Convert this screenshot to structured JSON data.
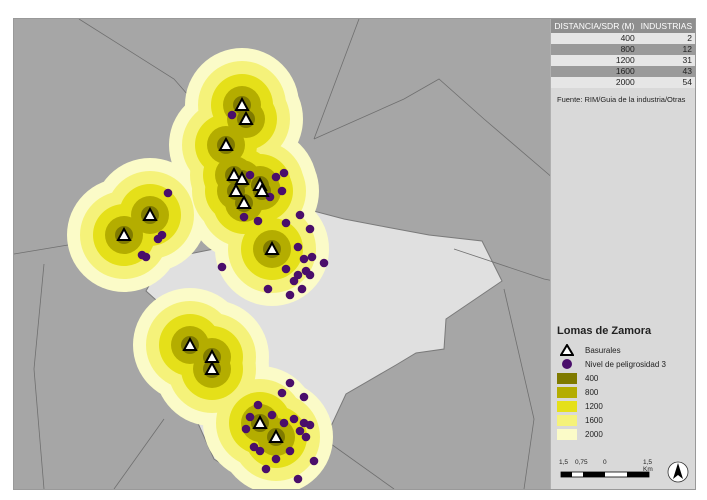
{
  "table": {
    "headers": [
      "DISTANCIA/SDR (M)",
      "INDUSTRIAS"
    ],
    "rows": [
      {
        "distance": "400",
        "count": "2"
      },
      {
        "distance": "800",
        "count": "12"
      },
      {
        "distance": "1200",
        "count": "31"
      },
      {
        "distance": "1600",
        "count": "43"
      },
      {
        "distance": "2000",
        "count": "54"
      }
    ]
  },
  "source": "Fuente: RIM/Guia de la industria/Otras",
  "legend": {
    "title": "Lomas de Zamora",
    "basurales": "Basurales",
    "nivel": "Nivel de peligrosidad 3",
    "buffers": [
      {
        "label": "400",
        "color": "#7f7a00"
      },
      {
        "label": "800",
        "color": "#b4ad00"
      },
      {
        "label": "1200",
        "color": "#e5e019"
      },
      {
        "label": "1600",
        "color": "#f5f27a"
      },
      {
        "label": "2000",
        "color": "#fbfbc8"
      }
    ]
  },
  "scalebar": {
    "labels": [
      "1,5",
      "0,75",
      "0",
      "1,5 Km"
    ]
  },
  "colors": {
    "point": "#4a0e6b",
    "district": "#e0e0e0",
    "background": "#a6a6a6"
  },
  "icons": {
    "basural": "triangle-icon",
    "industry": "circle-icon",
    "north": "north-arrow-icon"
  }
}
